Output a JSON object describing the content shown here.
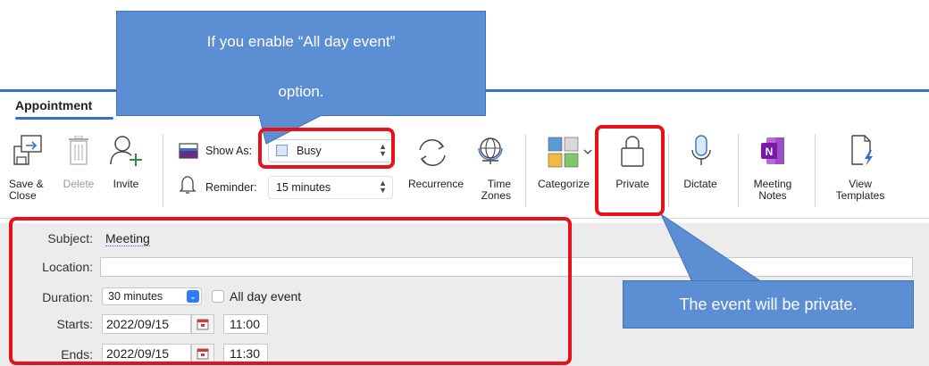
{
  "ribbon": {
    "tab_label": "Appointment",
    "buttons": {
      "save_close": {
        "line1": "Save &",
        "line2": "Close",
        "icon": "save-close-icon"
      },
      "delete": {
        "label": "Delete",
        "icon": "trash-icon"
      },
      "invite": {
        "label": "Invite",
        "icon": "invite-person-icon"
      },
      "recurrence": {
        "label": "Recurrence",
        "icon": "recurrence-icon"
      },
      "time_zones": {
        "line1": "Time",
        "line2": "Zones",
        "icon": "globe-icon"
      },
      "categorize": {
        "label": "Categorize",
        "icon": "category-grid-icon"
      },
      "private": {
        "label": "Private",
        "icon": "lock-icon"
      },
      "dictate": {
        "label": "Dictate",
        "icon": "microphone-icon"
      },
      "meeting_notes": {
        "line1": "Meeting",
        "line2": "Notes",
        "icon": "onenote-icon"
      },
      "view_templates": {
        "line1": "View",
        "line2": "Templates",
        "icon": "template-icon"
      }
    },
    "show_as": {
      "label": "Show As:",
      "value": "Busy"
    },
    "reminder": {
      "label": "Reminder:",
      "value": "15 minutes"
    }
  },
  "form": {
    "subject": {
      "label": "Subject:",
      "value": "Meeting"
    },
    "location": {
      "label": "Location:",
      "value": ""
    },
    "duration": {
      "label": "Duration:",
      "value": "30 minutes"
    },
    "all_day": {
      "label": "All day event",
      "checked": false
    },
    "starts": {
      "label": "Starts:",
      "date": "2022/09/15",
      "time": "11:00"
    },
    "ends": {
      "label": "Ends:",
      "date": "2022/09/15",
      "time": "11:30"
    }
  },
  "annotations": {
    "top_callout": {
      "line1": "If you enable “All day event”",
      "line2": "option."
    },
    "right_callout": "The event will be private."
  },
  "colors": {
    "accent": "#2f74c7",
    "highlight": "#e8101b",
    "callout": "#5b8ed3"
  }
}
